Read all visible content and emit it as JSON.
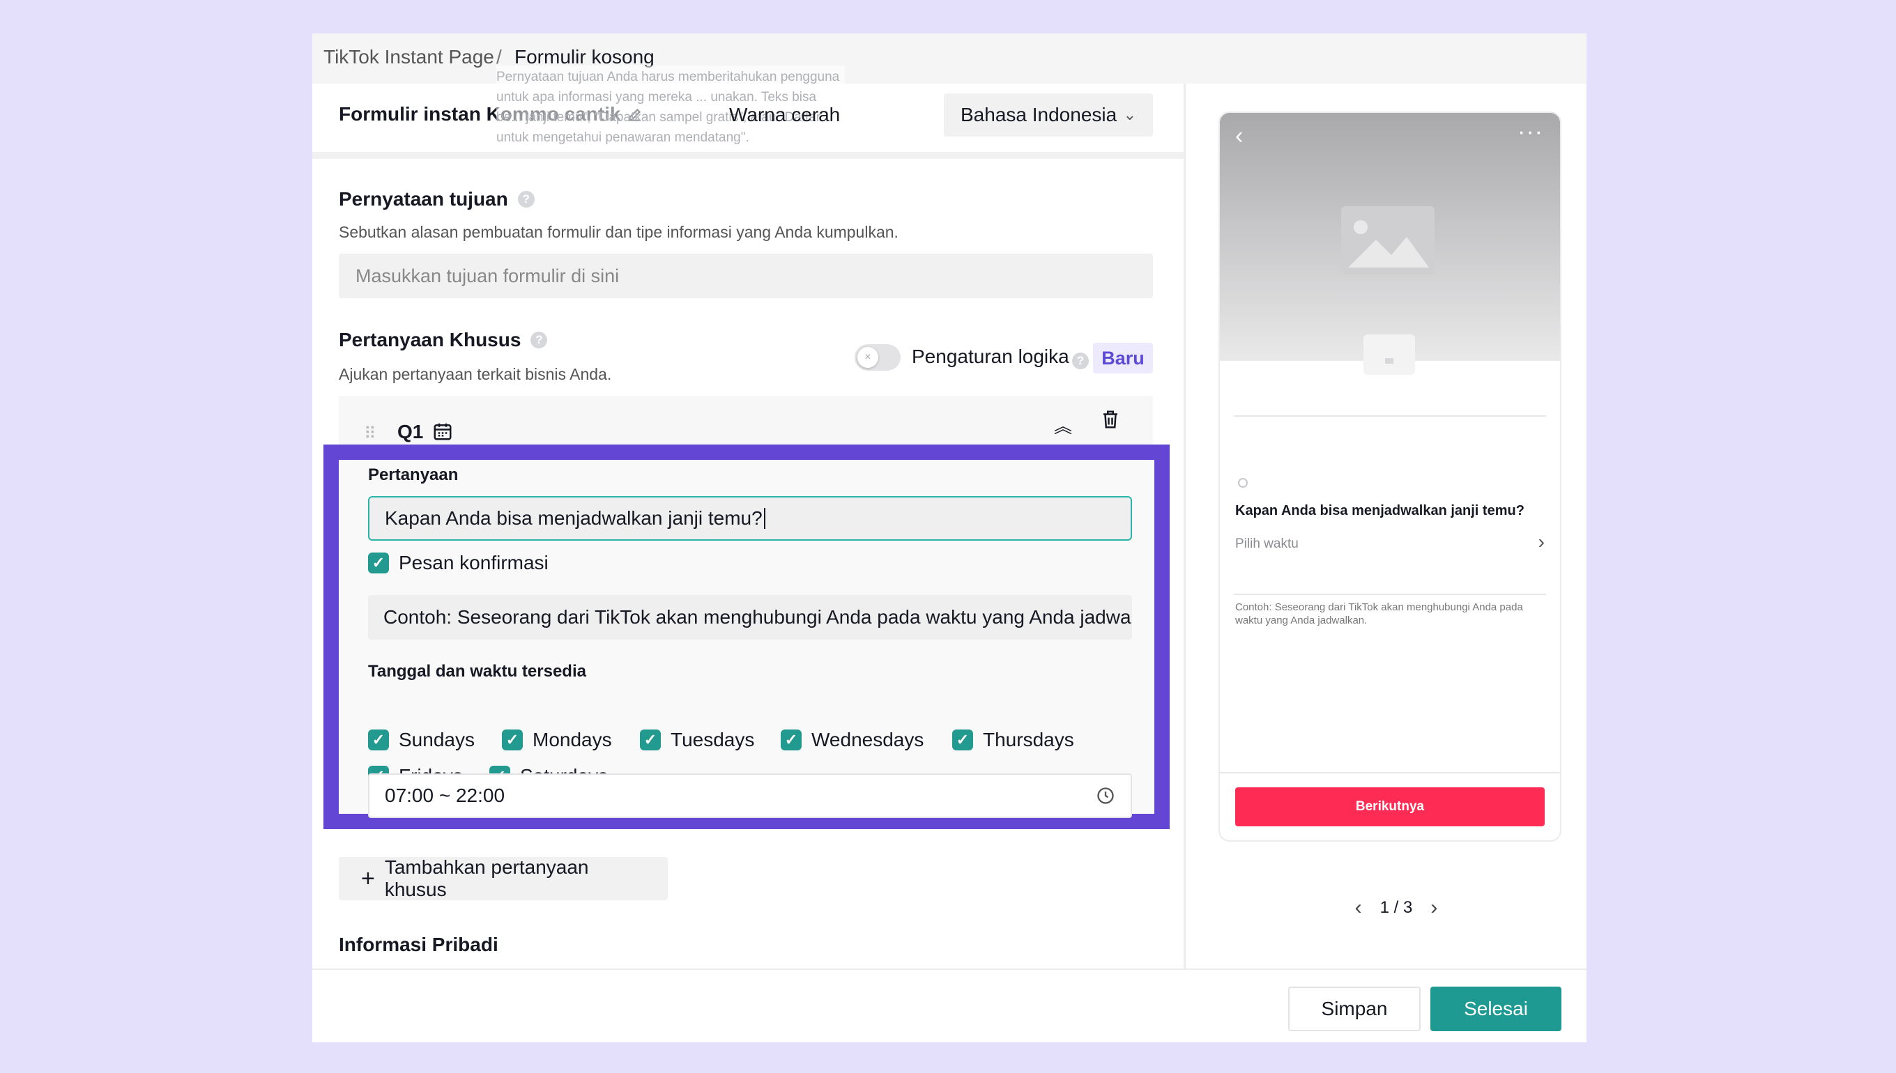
{
  "breadcrumb": {
    "root": "TikTok Instant Page",
    "separator": "/",
    "current": "Formulir kosong"
  },
  "tooltip_hint": "Pernyataan tujuan Anda harus memberitahukan pengguna untuk apa informasi yang mereka ... unakan. Teks bisa be... janji temu\", \"Dapatkan sampel gratis\", atau \"Daftar untuk mengetahui penawaran mendatang\".",
  "toolbar": {
    "form_name": "Formulir instan Kommo cantik",
    "theme_select": "Warna cerah",
    "language_select": "Bahasa Indonesia"
  },
  "purpose": {
    "title": "Pernyataan tujuan",
    "subtitle": "Sebutkan alasan pembuatan formulir dan tipe informasi yang Anda kumpulkan.",
    "placeholder": "Masukkan tujuan formulir di sini"
  },
  "custom_questions": {
    "title": "Pertanyaan Khusus",
    "subtitle": "Ajukan pertanyaan terkait bisnis Anda.",
    "logic_label": "Pengaturan logika",
    "new_badge": "Baru",
    "q_label": "Q1"
  },
  "question": {
    "label": "Pertanyaan",
    "value": "Kapan Anda bisa menjadwalkan janji temu?",
    "confirm_label": "Pesan konfirmasi",
    "example_text": "Contoh: Seseorang dari TikTok akan menghubungi Anda pada waktu yang Anda jadwall",
    "availability_label": "Tanggal dan waktu tersedia",
    "days": [
      "Sundays",
      "Mondays",
      "Tuesdays",
      "Wednesdays",
      "Thursdays",
      "Fridays",
      "Saturdays"
    ],
    "time_range": "07:00 ~ 22:00"
  },
  "add_question_label": "Tambahkan pertanyaan khusus",
  "personal_info_title": "Informasi Pribadi",
  "footer": {
    "save": "Simpan",
    "done": "Selesai"
  },
  "preview": {
    "question": "Kapan Anda bisa menjadwalkan janji temu?",
    "pick_placeholder": "Pilih waktu",
    "note": "Contoh: Seseorang dari TikTok akan menghubungi Anda pada waktu yang Anda jadwalkan.",
    "next": "Berikutnya",
    "page": "1 / 3"
  },
  "colors": {
    "accent": "#1e9a92",
    "highlight_border": "#6446d4",
    "cta": "#fe2c55",
    "background": "#e4e0fb"
  },
  "icons": [
    "edit-icon",
    "chevron-down-icon",
    "help-icon",
    "drag-handle-icon",
    "calendar-icon",
    "collapse-up-icon",
    "trash-icon",
    "check-icon",
    "clock-icon",
    "plus-icon",
    "back-icon",
    "more-icon",
    "image-placeholder-icon",
    "info-icon",
    "chevron-right-icon",
    "chevron-left-icon"
  ]
}
